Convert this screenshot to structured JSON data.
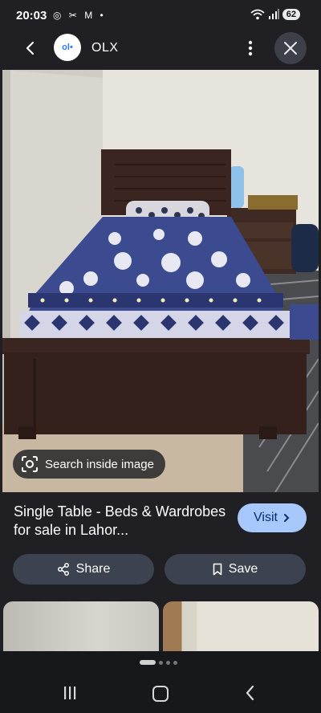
{
  "status_bar": {
    "time": "20:03",
    "left_icons": "◎ ✂ M •",
    "battery": "62"
  },
  "app_bar": {
    "site_logo_text": "ol•",
    "site_name": "OLX"
  },
  "image": {
    "lens_label": "Search inside image"
  },
  "result": {
    "title": "Single Table - Beds & Wardrobes for sale in Lahor...",
    "visit_label": "Visit",
    "share_label": "Share",
    "save_label": "Save"
  },
  "pager": {
    "count": 4,
    "active_index": 0
  },
  "colors": {
    "background": "#1f1f24",
    "visit_button": "#a8c7fa",
    "action_button": "#3c4250"
  }
}
